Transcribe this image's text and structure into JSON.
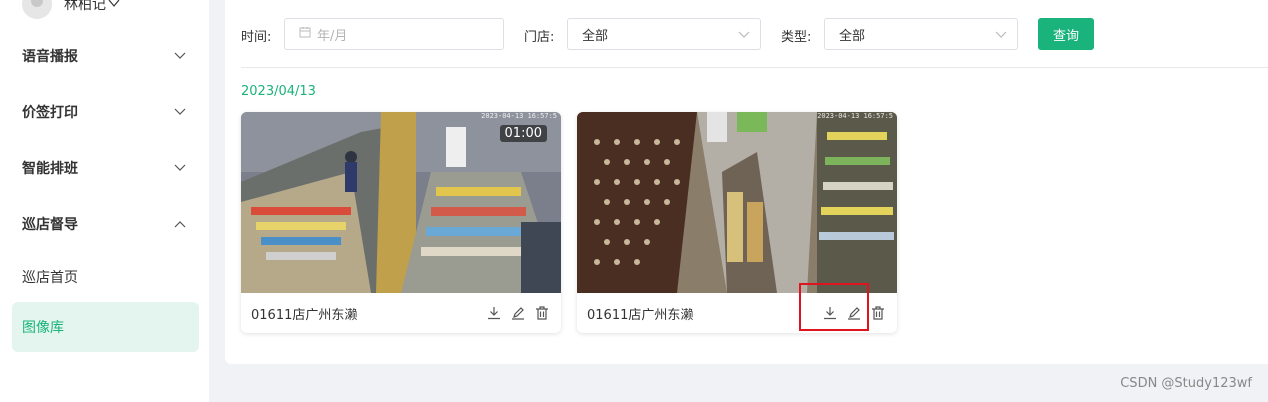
{
  "user": {
    "name": "林柏记",
    "caret": "﹀"
  },
  "sidebar": {
    "items": [
      {
        "label": "语音播报",
        "expanded": false
      },
      {
        "label": "价签打印",
        "expanded": false
      },
      {
        "label": "智能排班",
        "expanded": false
      },
      {
        "label": "巡店督导",
        "expanded": true
      }
    ],
    "sub_items": [
      {
        "label": "巡店首页",
        "active": false
      },
      {
        "label": "图像库",
        "active": true
      }
    ]
  },
  "filters": {
    "time_label": "时间:",
    "time_placeholder": "年/月",
    "store_label": "门店:",
    "store_value": "全部",
    "type_label": "类型:",
    "type_value": "全部",
    "query_label": "查询"
  },
  "gallery": {
    "date": "2023/04/13",
    "cards": [
      {
        "store": "01611店广州东濑",
        "duration": "01:00",
        "timestamp": "2023-04-13 16:57:5"
      },
      {
        "store": "01611店广州东濑",
        "duration": "",
        "timestamp": "2023-04-13 16:57:5"
      }
    ]
  },
  "watermark": "CSDN @Study123wf",
  "colors": {
    "accent": "#19b37b",
    "highlight": "#e0141e",
    "active_bg": "#e3f5ee"
  },
  "icons": [
    "chevron-down-icon",
    "chevron-up-icon",
    "calendar-icon",
    "download-icon",
    "edit-icon",
    "delete-icon"
  ]
}
